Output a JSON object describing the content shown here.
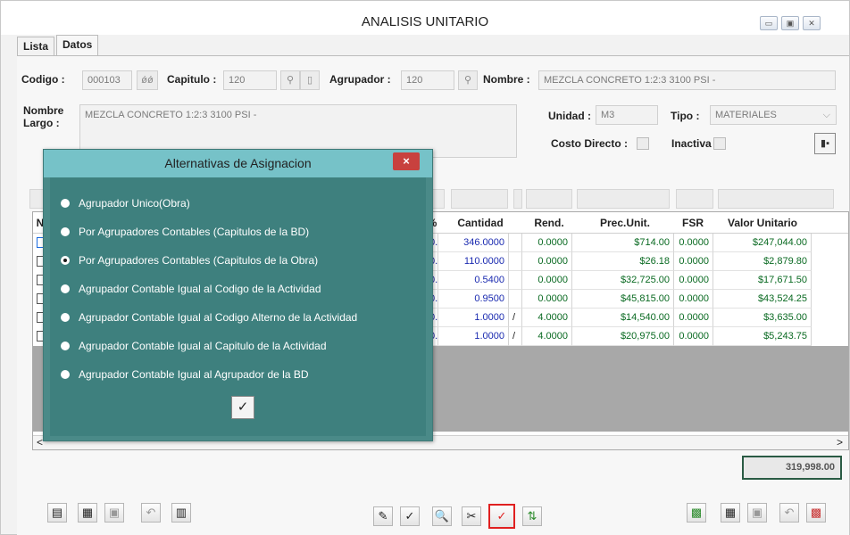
{
  "window": {
    "title": "ANALISIS UNITARIO",
    "controls": [
      "▭",
      "▣",
      "✕"
    ]
  },
  "tabs": [
    {
      "label": "Lista"
    },
    {
      "label": "Datos"
    }
  ],
  "form": {
    "codigo_label": "Codigo :",
    "codigo_value": "000103",
    "capitulo_label": "Capitulo :",
    "capitulo_value": "120",
    "agrupador_label": "Agrupador :",
    "agrupador_value": "120",
    "nombre_label": "Nombre :",
    "nombre_value": "MEZCLA CONCRETO 1:2:3 3100 PSI -",
    "nombre_largo_label_1": "Nombre",
    "nombre_largo_label_2": "Largo :",
    "nombre_largo_value": "MEZCLA CONCRETO 1:2:3 3100 PSI -",
    "unidad_label": "Unidad :",
    "unidad_value": "M3",
    "tipo_label": "Tipo :",
    "tipo_value": "MATERIALES",
    "costo_directo_label": "Costo Directo :",
    "inactiva_label": "Inactiva"
  },
  "grid": {
    "columns": {
      "pct": "%",
      "cantidad": "Cantidad",
      "rend": "Rend.",
      "prec_unit": "Prec.Unit.",
      "fsr": "FSR",
      "valor_unitario": "Valor Unitario",
      "first": "N"
    },
    "rows": [
      {
        "pct": "0...",
        "cantidad": "346.0000",
        "slash": "",
        "rend": "0.0000",
        "prec_unit": "$714.00",
        "fsr": "0.0000",
        "valor_unitario": "$247,044.00"
      },
      {
        "pct": "0...",
        "cantidad": "110.0000",
        "slash": "",
        "rend": "0.0000",
        "prec_unit": "$26.18",
        "fsr": "0.0000",
        "valor_unitario": "$2,879.80"
      },
      {
        "pct": "0...",
        "cantidad": "0.5400",
        "slash": "",
        "rend": "0.0000",
        "prec_unit": "$32,725.00",
        "fsr": "0.0000",
        "valor_unitario": "$17,671.50"
      },
      {
        "pct": "0...",
        "cantidad": "0.9500",
        "slash": "",
        "rend": "0.0000",
        "prec_unit": "$45,815.00",
        "fsr": "0.0000",
        "valor_unitario": "$43,524.25"
      },
      {
        "pct": "0...",
        "cantidad": "1.0000",
        "slash": "/",
        "rend": "4.0000",
        "prec_unit": "$14,540.00",
        "fsr": "0.0000",
        "valor_unitario": "$3,635.00"
      },
      {
        "pct": "0...",
        "cantidad": "1.0000",
        "slash": "/",
        "rend": "4.0000",
        "prec_unit": "$20,975.00",
        "fsr": "0.0000",
        "valor_unitario": "$5,243.75"
      }
    ],
    "scroll_left": "<",
    "scroll_right": ">"
  },
  "total": "319,998.00",
  "dialog": {
    "title": "Alternativas de Asignacion",
    "close": "×",
    "options": [
      {
        "label": "Agrupador Unico(Obra)",
        "selected": false
      },
      {
        "label": "Por Agrupadores Contables (Capitulos de la BD)",
        "selected": false
      },
      {
        "label": "Por Agrupadores Contables (Capitulos de la Obra)",
        "selected": true
      },
      {
        "label": "Agrupador Contable Igual al Codigo de la Actividad",
        "selected": false
      },
      {
        "label": "Agrupador Contable Igual al Codigo Alterno de la Actividad",
        "selected": false
      },
      {
        "label": "Agrupador Contable Igual al Capitulo de la Actividad",
        "selected": false
      },
      {
        "label": "Agrupador Contable Igual al Agrupador de la BD",
        "selected": false
      }
    ],
    "ok": "✓"
  },
  "toolbar": {
    "left": [
      "▤",
      "▦",
      "▣",
      "↶",
      "▥"
    ],
    "center": [
      "✎",
      "✓",
      "🔍",
      "✂",
      "✓",
      "⇅"
    ],
    "right": [
      "▩",
      "▦",
      "▣",
      "↶",
      "▩"
    ]
  },
  "colors": {
    "dialog_bg": "#3e807e",
    "dialog_title": "#76c2c8",
    "close_red": "#c8413e",
    "total_border": "#2a5b44",
    "highlight": "#e02020"
  }
}
